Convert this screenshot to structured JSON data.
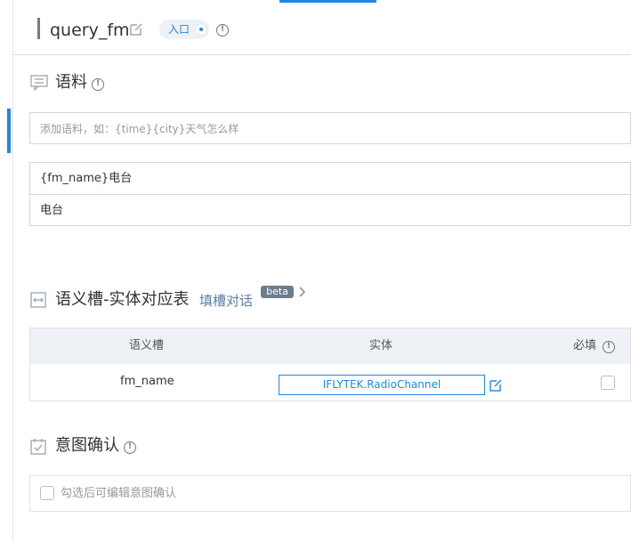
{
  "header": {
    "title": "query_fm",
    "entry_toggle_label": "入口"
  },
  "corpus": {
    "section_title": "语料",
    "input_placeholder": "添加语料，如：{time}{city}天气怎么样",
    "items": [
      {
        "text": "{fm_name}电台"
      },
      {
        "text": "电台"
      }
    ]
  },
  "slots": {
    "section_title": "语义槽-实体对应表",
    "fill_dialog_link": "填槽对话",
    "beta_badge": "beta",
    "columns": {
      "slot": "语义槽",
      "entity": "实体",
      "required": "必填"
    },
    "rows": [
      {
        "slot": "fm_name",
        "entity": "IFLYTEK.RadioChannel",
        "required": false
      }
    ]
  },
  "intent_confirm": {
    "section_title": "意图确认",
    "checkbox_label": "勾选后可编辑意图确认"
  },
  "colors": {
    "accent": "#1e88e5",
    "border": "#d6d6d6",
    "table_header_bg": "#eef1f5"
  }
}
